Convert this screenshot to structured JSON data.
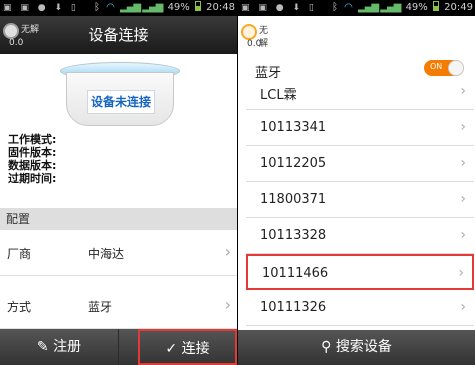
{
  "left": {
    "status": {
      "icons_left": "▣ ▣ ● ⬇ ▯",
      "bt": "ᛒ",
      "signal": "▂▄▆ ▂▄▆",
      "battery_pct": "49%",
      "time": "20:48"
    },
    "fix": {
      "label": "无解",
      "value": "0.0"
    },
    "title": "设备连接",
    "device_status": "设备未连接",
    "info": {
      "work_mode": "工作模式:",
      "firmware": "固件版本:",
      "data_version": "数据版本:",
      "expire": "过期时间:"
    },
    "config_header": "配置",
    "settings": [
      {
        "key": "厂商",
        "value": "中海达"
      },
      {
        "key": "方式",
        "value": "蓝牙"
      }
    ],
    "bottom": {
      "register": "注册",
      "connect": "连接"
    }
  },
  "right": {
    "status": {
      "icons_left": "▣ ▣ ● ⬇ ▯",
      "bt": "ᛒ",
      "signal": "▂▄▆ ▂▄▆",
      "battery_pct": "49%",
      "time": "20:49"
    },
    "fix": {
      "label": "无解",
      "value": "0.0"
    },
    "bluetooth_label": "蓝牙",
    "toggle": "ON",
    "devices": [
      "LCL霖",
      "10113341",
      "10112205",
      "11800371",
      "10113328",
      "10111466",
      "10111326"
    ],
    "selected_device": "10111466",
    "search_button": "搜索设备"
  },
  "colors": {
    "accent_orange": "#f57c00",
    "highlight_red": "#e53935",
    "link_blue": "#1565c0"
  }
}
